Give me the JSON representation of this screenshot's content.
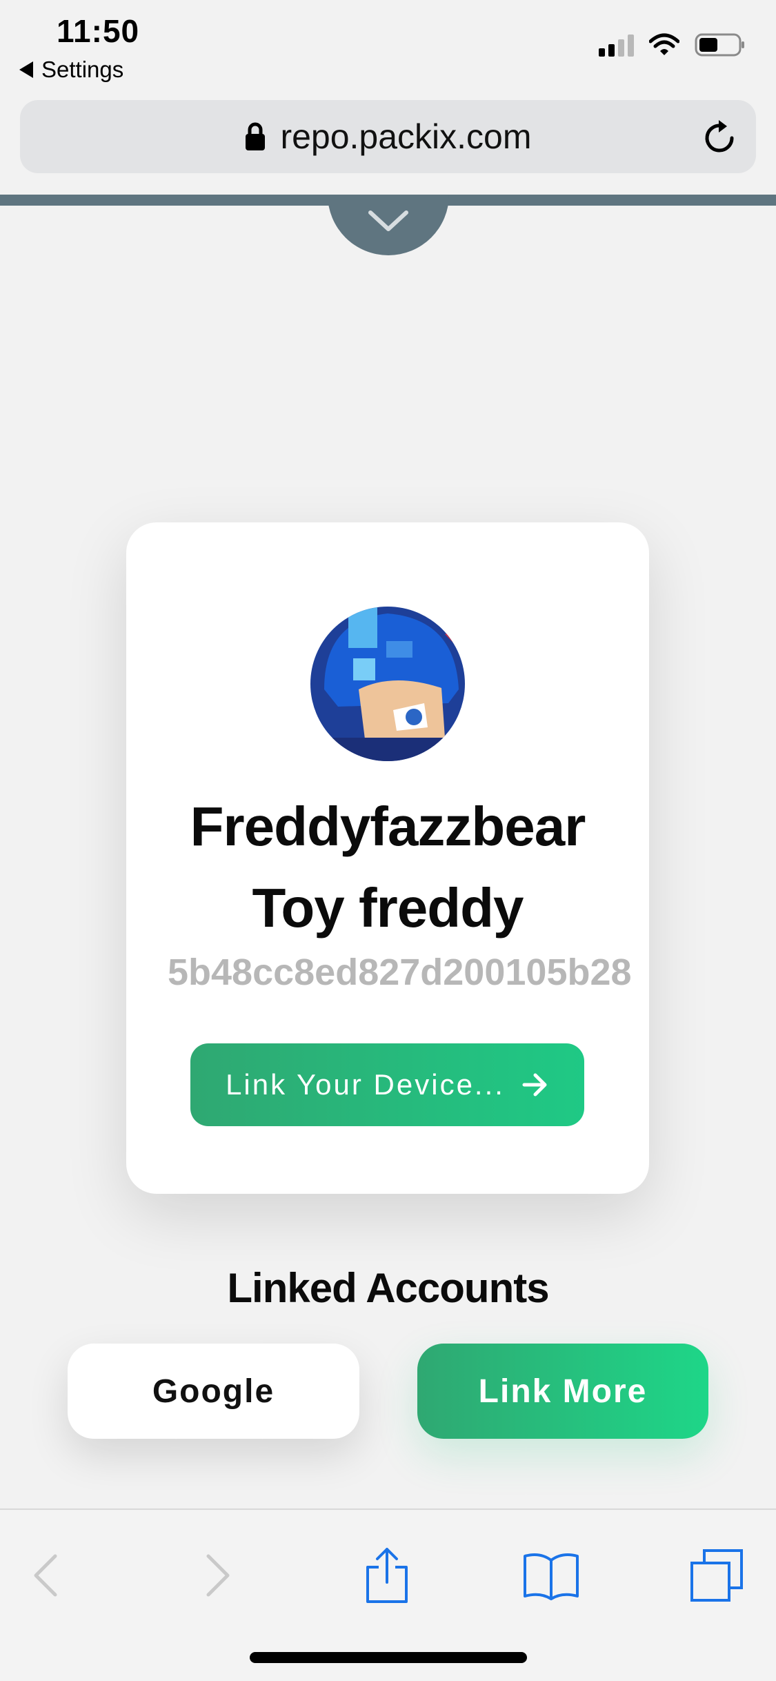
{
  "status_bar": {
    "time": "11:50",
    "back_label": "Settings"
  },
  "browser": {
    "url": "repo.packix.com"
  },
  "profile": {
    "display_name": "Freddyfazzbear",
    "username": "Toy freddy",
    "user_id": "5b48cc8ed827d200105b28",
    "link_device_label": "Link Your Device..."
  },
  "linked_accounts": {
    "title": "Linked Accounts",
    "google_label": "Google",
    "link_more_label": "Link More"
  },
  "colors": {
    "accent_green": "#1fc985",
    "slate_band": "#5f7580",
    "toolbar_blue": "#1a73e8"
  },
  "icons": {
    "lock": "lock-icon",
    "reload": "reload-icon",
    "back": "chevron-left-icon",
    "forward": "chevron-right-icon",
    "share": "share-icon",
    "bookmarks": "book-icon",
    "tabs": "tabs-icon"
  }
}
